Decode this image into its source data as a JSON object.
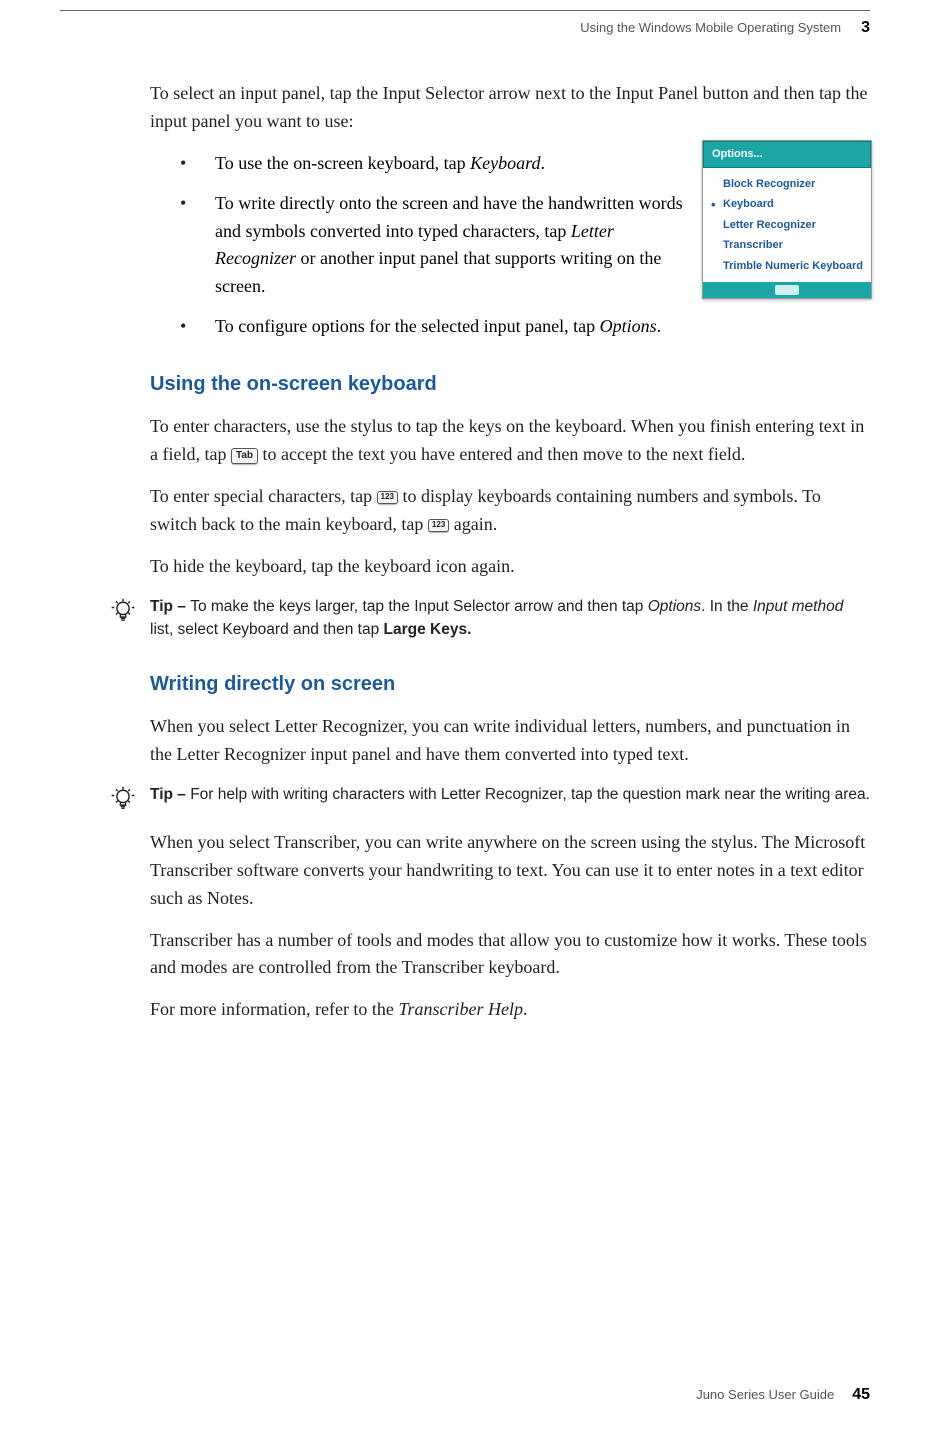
{
  "header": {
    "title": "Using the Windows Mobile Operating System",
    "chapter": "3"
  },
  "intro": "To select an input panel, tap the Input Selector arrow next to the Input Panel button and then tap the input panel you want to use:",
  "bullets": {
    "b1_pre": "To  use the on-screen keyboard, tap ",
    "b1_em": "Keyboard",
    "b1_post": ".",
    "b2_pre": "To write directly onto the screen and have the handwritten words and symbols converted into typed characters, tap ",
    "b2_em": "Letter Recognizer",
    "b2_post": " or another input panel that supports writing on the screen.",
    "b3_pre": "To configure options for the selected input panel, tap ",
    "b3_em": "Options",
    "b3_post": "."
  },
  "section1": {
    "heading": "Using the on-screen keyboard",
    "p1a": "To enter characters, use the stylus to tap the keys on the keyboard. When you finish entering text in a field, tap ",
    "tab_label": "Tab",
    "p1b": " to accept the text you have entered and then move to the next field.",
    "p2a": "To enter special characters, tap ",
    "num_label": "123",
    "p2b": " to display keyboards containing numbers and symbols. To switch back to the main keyboard, tap ",
    "p2c": " again.",
    "p3": "To hide the keyboard, tap the keyboard icon again."
  },
  "tip1": {
    "label": "Tip – ",
    "t1": "To make the keys larger, tap the Input Selector arrow and then tap ",
    "em1": "Options",
    "t2": ". In the ",
    "em2": "Input method",
    "t3": " list, select Keyboard and then tap ",
    "bold": "Large Keys."
  },
  "section2": {
    "heading": "Writing directly on screen",
    "p1": "When you select Letter Recognizer, you can write individual letters, numbers, and punctuation in the Letter Recognizer input panel and have them converted into typed text."
  },
  "tip2": {
    "label": "Tip – ",
    "text": "For help with writing characters with Letter Recognizer, tap the question mark near the writing area."
  },
  "section2b": {
    "p2": "When you select Transcriber, you can write anywhere on the screen using the stylus. The Microsoft Transcriber software converts your handwriting to text. You can use it to enter notes in a text editor such as Notes.",
    "p3": "Transcriber has a number of tools and modes that allow you to customize how it works. These tools and modes are controlled from the Transcriber keyboard.",
    "p4a": "For more information, refer to the ",
    "p4em": "Transcriber Help",
    "p4b": "."
  },
  "screenshot": {
    "options": "Options...",
    "items": [
      "Block Recognizer",
      "Keyboard",
      "Letter Recognizer",
      "Transcriber",
      "Trimble Numeric Keyboard"
    ],
    "selected_index": 1
  },
  "footer": {
    "title": "Juno Series User Guide",
    "page": "45"
  }
}
